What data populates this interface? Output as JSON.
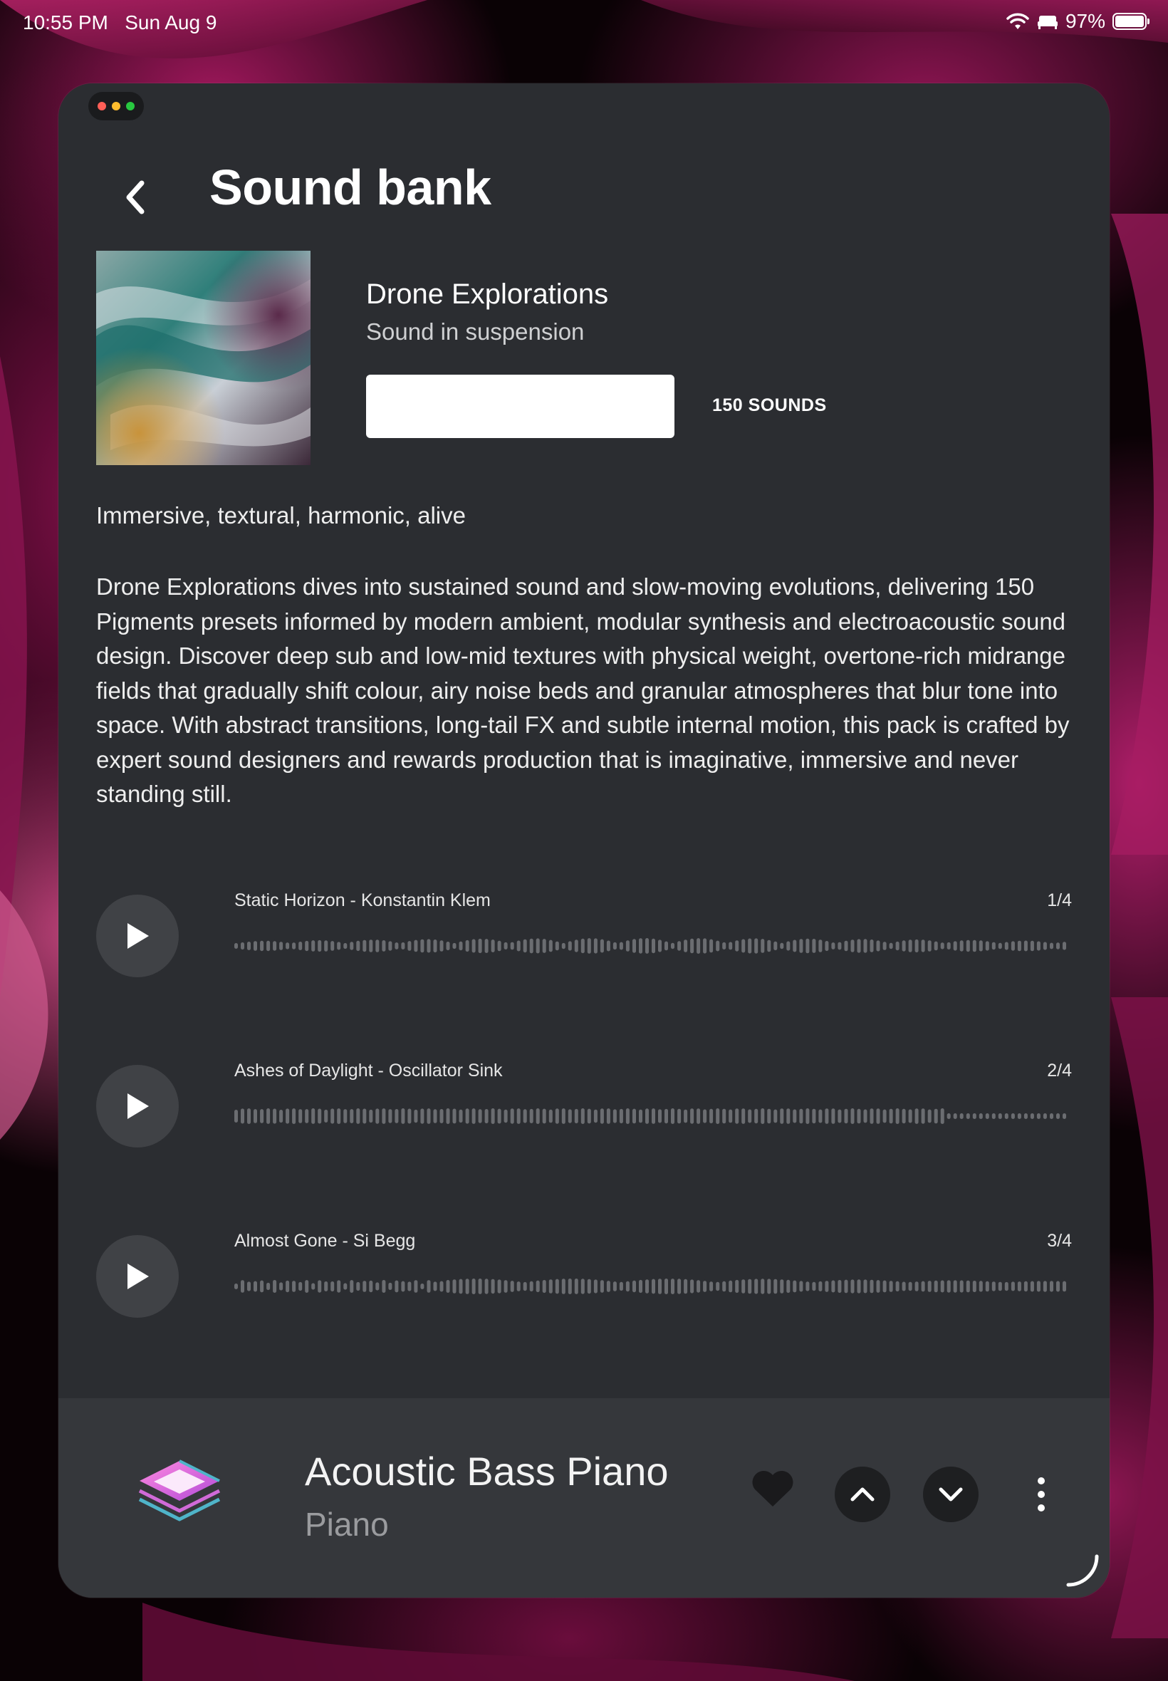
{
  "status_bar": {
    "time": "10:55 PM",
    "date": "Sun Aug 9",
    "battery": "97%",
    "battery_level": 0.97
  },
  "window_dots_colors": [
    "#ff5f57",
    "#febc2e",
    "#28c840"
  ],
  "header": {
    "title": "Sound bank",
    "back_icon": "chevron-left-icon"
  },
  "pack": {
    "name": "Drone Explorations",
    "subtitle": "Sound in suspension",
    "preview_button_label": "",
    "sounds_count": "150 SOUNDS",
    "tags": "Immersive, textural, harmonic, alive",
    "description": "Drone Explorations dives into sustained sound and slow-moving evolutions, delivering 150 Pigments presets informed by modern ambient, modular synthesis and electroacoustic sound design. Discover deep sub and low-mid textures with physical weight, overtone-rich midrange fields that gradually shift colour, airy noise beds and granular atmospheres that blur tone into space. With abstract transitions, long-tail FX and subtle internal motion, this pack is crafted by expert sound designers and rewards production that is imaginative, immersive and never standing still."
  },
  "tracks": [
    {
      "title": "Static Horizon - Konstantin Klem",
      "index": "1/4"
    },
    {
      "title": "Ashes of Daylight - Oscillator Sink",
      "index": "2/4"
    },
    {
      "title": "Almost Gone - Si Begg",
      "index": "3/4"
    }
  ],
  "now_playing": {
    "name": "Acoustic Bass Piano",
    "category": "Piano",
    "icons": [
      "layers-icon",
      "heart-icon",
      "chevron-up-icon",
      "chevron-down-icon",
      "more-vertical-icon"
    ]
  },
  "colors": {
    "window_bg": "#2b2d31",
    "bottom_bar_bg": "#35373b",
    "play_button_bg": "#404246"
  }
}
